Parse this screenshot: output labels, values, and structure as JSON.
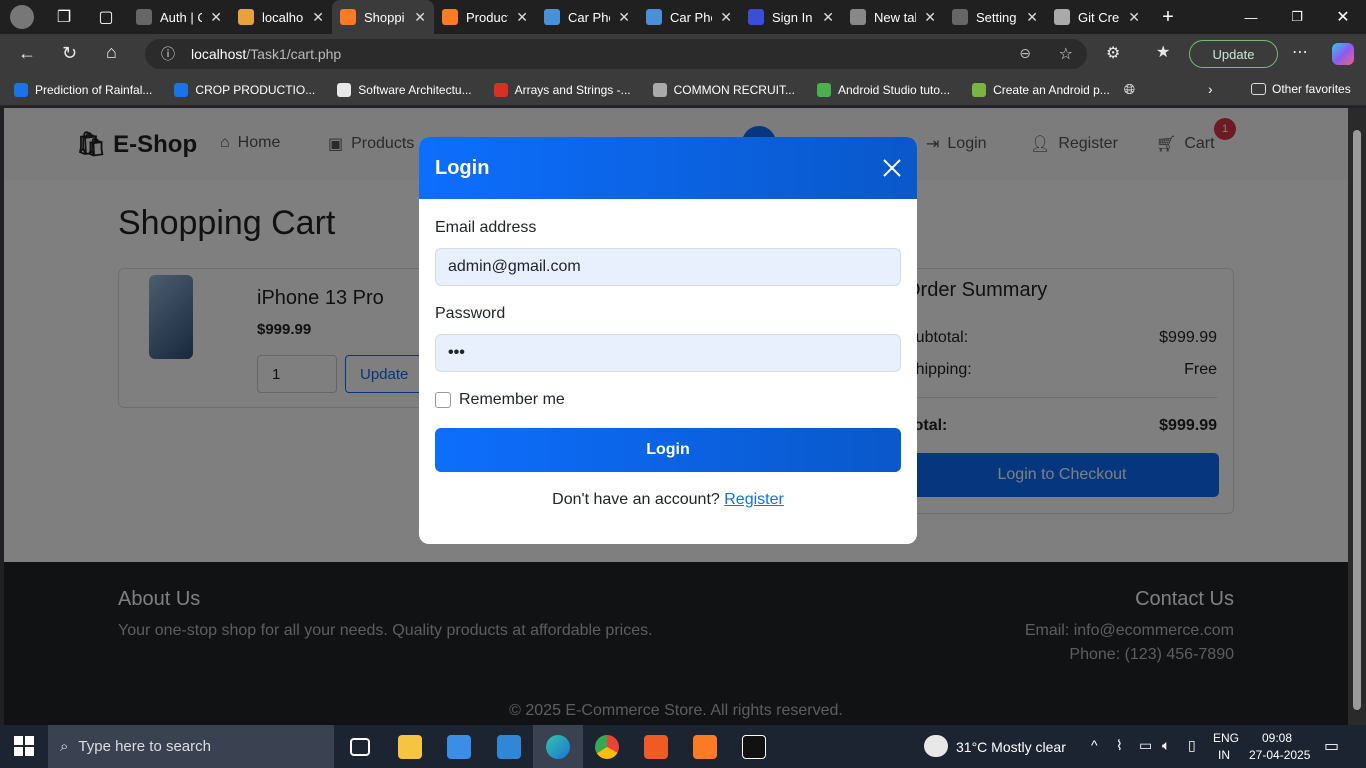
{
  "browser": {
    "tabs": [
      {
        "title": "Auth | C",
        "color": "#666666"
      },
      {
        "title": "localho",
        "color": "#e9a23b"
      },
      {
        "title": "Shoppi",
        "color": "#fb7a24",
        "active": true
      },
      {
        "title": "Product",
        "color": "#fb7a24"
      },
      {
        "title": "Car Pho",
        "color": "#4a90d9"
      },
      {
        "title": "Car Pho",
        "color": "#4a90d9"
      },
      {
        "title": "Sign In",
        "color": "#3b4fd6"
      },
      {
        "title": "New tal",
        "color": "#888888"
      },
      {
        "title": "Setting",
        "color": "#666666"
      },
      {
        "title": "Git Cre",
        "color": "#aaaaaa"
      }
    ],
    "url_host": "localhost",
    "url_path": "/Task1/cart.php",
    "update_label": "Update",
    "bookmarks": [
      {
        "label": "Prediction of Rainfal...",
        "color": "#1a73e8"
      },
      {
        "label": "CROP PRODUCTIO...",
        "color": "#1a73e8"
      },
      {
        "label": "Software Architectu...",
        "color": "#e8e8e8"
      },
      {
        "label": "Arrays and Strings -...",
        "color": "#d93025"
      },
      {
        "label": "COMMON RECRUIT...",
        "color": "#aaaaaa"
      },
      {
        "label": "Android Studio tuto...",
        "color": "#4caf50"
      },
      {
        "label": "Create an Android p...",
        "color": "#7cb342"
      }
    ],
    "other_favorites": "Other favorites"
  },
  "site": {
    "brand": "E-Shop",
    "nav": {
      "home": "Home",
      "products": "Products",
      "login": "Login",
      "register": "Register",
      "cart": "Cart",
      "cart_count": "1"
    },
    "page_title": "Shopping Cart",
    "item": {
      "name": "iPhone 13 Pro",
      "price": "$999.99",
      "qty": "1",
      "update": "Update"
    },
    "summary": {
      "heading": "Order Summary",
      "subtotal_label": "Subtotal:",
      "subtotal": "$999.99",
      "shipping_label": "Shipping:",
      "shipping": "Free",
      "total_label": "Total:",
      "total": "$999.99",
      "checkout": "Login to Checkout"
    },
    "footer": {
      "about_title": "About Us",
      "about_text": "Your one-stop shop for all your needs. Quality products at affordable prices.",
      "contact_title": "Contact Us",
      "email": "Email: info@ecommerce.com",
      "phone": "Phone: (123) 456-7890",
      "copyright": "© 2025 E-Commerce Store. All rights reserved."
    }
  },
  "modal": {
    "title": "Login",
    "email_label": "Email address",
    "email_value": "admin@gmail.com",
    "password_label": "Password",
    "password_value": "•••",
    "remember": "Remember me",
    "submit": "Login",
    "no_account": "Don't have an account?",
    "register_link": "Register"
  },
  "taskbar": {
    "search_placeholder": "Type here to search",
    "weather": "31°C  Mostly clear",
    "lang1": "ENG",
    "lang2": "IN",
    "time": "09:08",
    "date": "27-04-2025"
  }
}
